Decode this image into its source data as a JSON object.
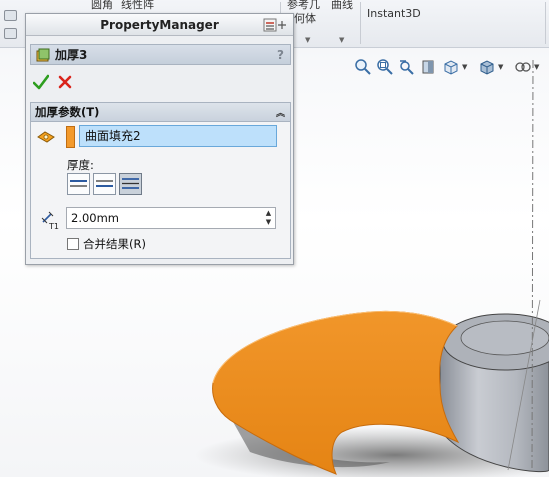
{
  "ribbon": {
    "item_a": "圆角",
    "item_b": "线性阵",
    "item_c": "参考几",
    "item_c2": "何体",
    "item_d": "曲线",
    "item_e": "Instant3D"
  },
  "panel": {
    "title": "PropertyManager",
    "feature_name": "加厚3",
    "help": "?",
    "group_title": "加厚参数(T)",
    "selected_face": "曲面填充2",
    "thickness_label": "厚度:",
    "thickness_value": "2.00mm",
    "merge_label": "合并结果(R)",
    "merge_checked": false,
    "thickness_side_selected": "both"
  },
  "icons": {
    "ok": "checkmark-icon",
    "cancel": "x-icon",
    "feature": "thicken-feature-icon",
    "face": "face-selection-icon",
    "distance": "t1-distance-icon"
  },
  "colors": {
    "accent_orange": "#f39a2c",
    "selection_blue": "#bde0fb",
    "ok_green": "#2e9e1f",
    "cancel_red": "#d9231b"
  }
}
